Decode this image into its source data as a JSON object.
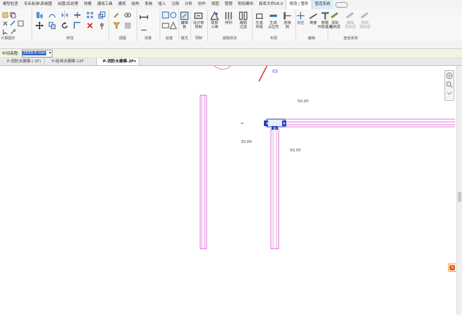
{
  "ribbon_tabs": [
    "模型检查",
    "专业标准\\系统图",
    "出图\\后处理",
    "快模",
    "通用工具",
    "建筑",
    "结构",
    "系统",
    "插入",
    "注释",
    "分析",
    "协作",
    "视图",
    "管理",
    "附加模块",
    "族库大师V6.0",
    "修改 | 管件",
    "管道系统"
  ],
  "ribbon_active_tab": "修改 | 管件",
  "panels": {
    "modify": "修改",
    "view": "视图",
    "measure": "测量",
    "create": "创建",
    "mode": "模式",
    "fabrication": "预制",
    "insulation": "减隔修改",
    "layout": "布局",
    "edit": "编辑",
    "piping_systems": "管道系统"
  },
  "left_panel_label": "计算图形",
  "tools": {
    "edit_family": [
      "编辑",
      "族"
    ],
    "design_fab": [
      "设计到",
      "预制"
    ],
    "local_3d": [
      "局部",
      "三维"
    ],
    "sort": [
      "排列",
      ""
    ],
    "insulation_filter": [
      "缩隔",
      "过滤"
    ],
    "gen_layout": [
      "生成",
      "布局"
    ],
    "gen_placeholder": [
      "生成",
      "占位符"
    ],
    "connect": [
      "连接",
      "到"
    ],
    "align": [
      "对正",
      ""
    ],
    "slope": [
      "坡度",
      ""
    ],
    "cap_open": [
      "管帽",
      "开放端点"
    ],
    "add_insulation": [
      "添加",
      "隔热层"
    ],
    "edit_insulation": [
      "编辑",
      "隔热层"
    ],
    "remove_insulation": [
      "删除",
      "隔热层"
    ]
  },
  "options": {
    "middle_elevation_label": "中间高程:",
    "middle_elevation_value": "2500.0 mm"
  },
  "doc_tabs": [
    {
      "label": "P-消防水建模-(-1F)",
      "active": false
    },
    {
      "label": "P-给排水建模-12F",
      "active": false
    },
    {
      "label": "P-消防水建模-2F",
      "active": true
    }
  ],
  "canvas_labels": {
    "dim_top": "50.00",
    "dim_left": "30.00",
    "dim_right": "50.00"
  },
  "colors": {
    "pipe": "#d64ad0",
    "fitting": "#1f3fbf",
    "arrow": "#e02020",
    "ctx_tab": "#d9edf7"
  },
  "ime_label": "英"
}
